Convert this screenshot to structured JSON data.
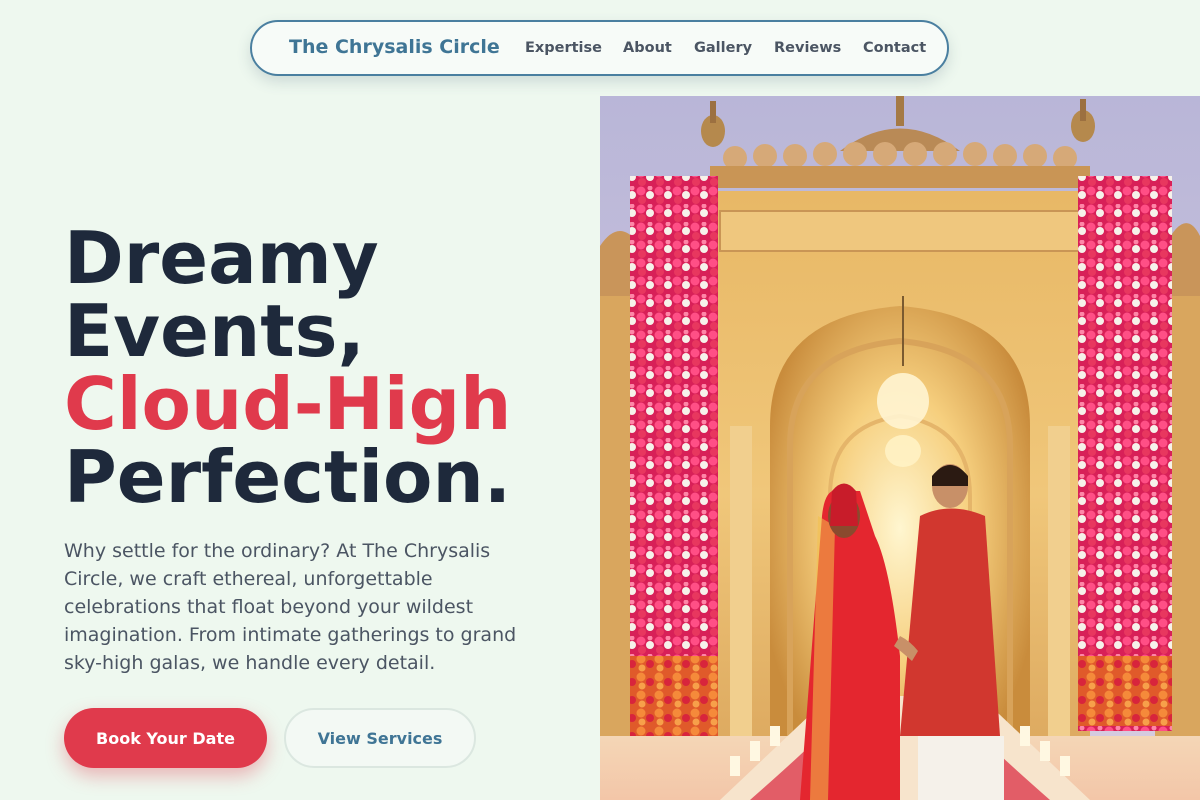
{
  "nav": {
    "brand": "The Chrysalis Circle",
    "links": [
      "Expertise",
      "About",
      "Gallery",
      "Reviews",
      "Contact"
    ]
  },
  "hero": {
    "title_line1": "Dreamy",
    "title_line2": "Events,",
    "title_accent": "Cloud-High",
    "title_line4": "Perfection.",
    "description": "Why settle for the ordinary? At The Chrysalis Circle, we craft ethereal, unforgettable celebrations that float beyond your wildest imagination. From intimate gatherings to grand sky-high galas, we handle every detail.",
    "primary_button": "Book Your Date",
    "secondary_button": "View Services"
  },
  "colors": {
    "background": "#eef8ef",
    "brand": "#3f7595",
    "accent": "#e03a4c",
    "heading": "#1e293b",
    "body_text": "#4b5563"
  }
}
